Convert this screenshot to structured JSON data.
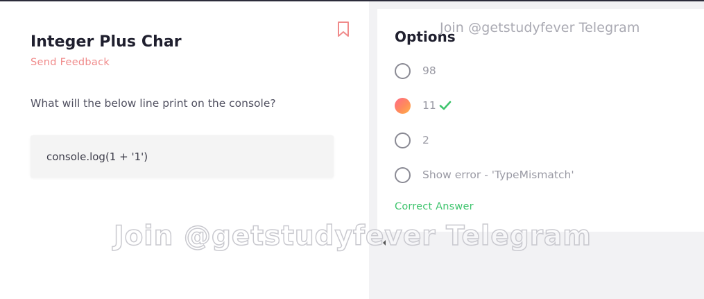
{
  "question": {
    "title": "Integer Plus Char",
    "feedback_label": "Send Feedback",
    "prompt": "What will the below line print on the console?",
    "code": "console.log(1 + '1')"
  },
  "options_panel": {
    "title": "Options",
    "options": [
      {
        "label": "98",
        "selected": false,
        "correct": false
      },
      {
        "label": "11",
        "selected": true,
        "correct": true
      },
      {
        "label": "2",
        "selected": false,
        "correct": false
      },
      {
        "label": "Show error - 'TypeMismatch'",
        "selected": false,
        "correct": false
      }
    ],
    "result_label": "Correct Answer"
  },
  "watermark": {
    "small": "Join @getstudyfever Telegram",
    "large": "Join @getstudyfever Telegram"
  },
  "icons": {
    "bookmark": "bookmark-icon",
    "check": "check-icon",
    "scroll": "scroll-left-arrow-icon"
  },
  "colors": {
    "feedback": "#f08a8a",
    "correct": "#3ec46d",
    "title": "#1f1f2e"
  }
}
